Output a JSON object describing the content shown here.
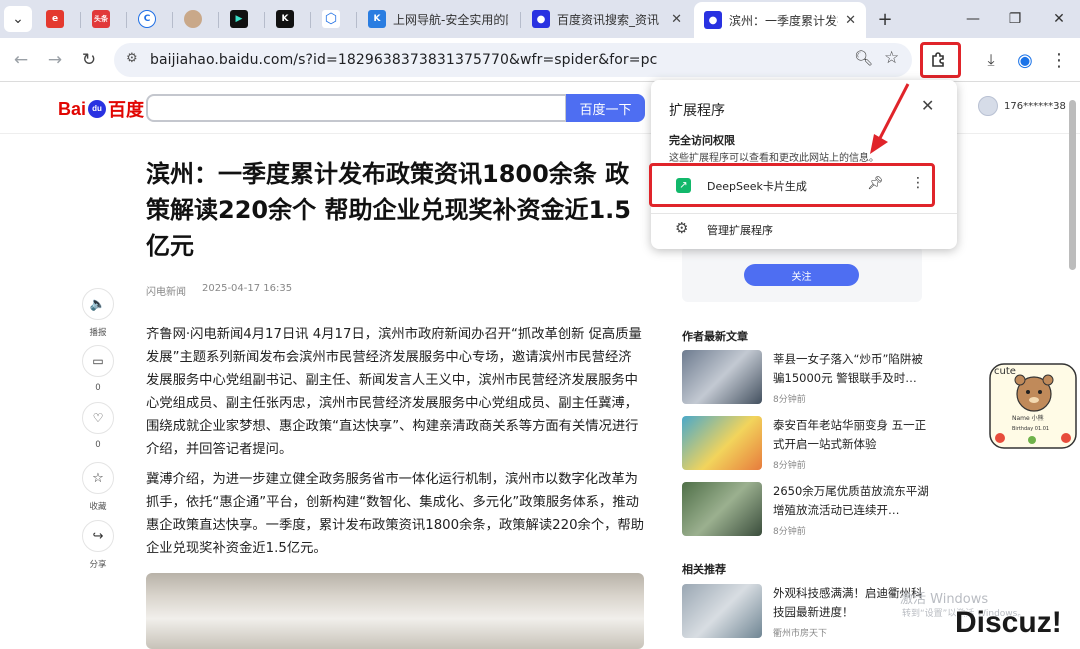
{
  "browser": {
    "tabs": [
      {
        "title": "",
        "favicon": "red-box",
        "favicon_text": "e",
        "color": "#e4392f"
      },
      {
        "title": "",
        "favicon": "toutiao",
        "favicon_text": "头条",
        "color": "#e1393a"
      },
      {
        "title": "",
        "favicon": "blue-c",
        "favicon_text": "C",
        "color": "#1f6fe5"
      },
      {
        "title": "",
        "favicon": "avatar",
        "favicon_text": "",
        "color": "#c9a889"
      },
      {
        "title": "",
        "favicon": "play",
        "favicon_text": "▶",
        "color": "#111111"
      },
      {
        "title": "",
        "favicon": "k-logo",
        "favicon_text": "K",
        "color": "#111111"
      },
      {
        "title": "",
        "favicon": "hex",
        "favicon_text": "⬡",
        "color": "#1f6fe5"
      },
      {
        "title": "上网导航-安全实用的网",
        "favicon": "k-blue",
        "favicon_text": "K",
        "color": "#2a7de1"
      },
      {
        "title": "百度资讯搜索_资讯",
        "favicon": "baidu-paw",
        "favicon_text": "🐾",
        "color": "#2932e1"
      },
      {
        "title": "滨州：一季度累计发布",
        "favicon": "baidu-paw",
        "favicon_text": "🐾",
        "color": "#2932e1",
        "active": true
      }
    ],
    "new_tab": "+",
    "url": "baijiahao.baidu.com/s?id=1829638373831375770&wfr=spider&for=pc"
  },
  "baidu": {
    "logo": "Bai百度",
    "search_button": "百度一下",
    "user": "176******38"
  },
  "article": {
    "title": "滨州：一季度累计发布政策资讯1800余条 政策解读220余个 帮助企业兑现奖补资金近1.5亿元",
    "source": "闪电新闻",
    "time": "2025-04-17 16:35",
    "para1": "齐鲁网·闪电新闻4月17日讯 4月17日，滨州市政府新闻办召开“抓改革创新 促高质量发展”主题系列新闻发布会滨州市民营经济发展服务中心专场，邀请滨州市民营经济发展服务中心党组副书记、副主任、新闻发言人王义中，滨州市民营经济发展服务中心党组成员、副主任张丙忠，滨州市民营经济发展服务中心党组成员、副主任冀溥，围绕成就企业家梦想、惠企政策“直达快享”、构建亲清政商关系等方面有关情况进行介绍，并回答记者提问。",
    "para2": "冀溥介绍，为进一步建立健全政务服务省市一体化运行机制，滨州市以数字化改革为抓手，依托“惠企通”平台，创新构建“数智化、集成化、多元化”政策服务体系，推动惠企政策直达快享。一季度，累计发布政策资讯1800余条，政策解读220余个，帮助企业兑现奖补资金近1.5亿元。"
  },
  "side_actions": [
    {
      "icon": "speaker-icon",
      "glyph": "🔈",
      "label": "播报"
    },
    {
      "icon": "comment-icon",
      "glyph": "💬",
      "label": "0"
    },
    {
      "icon": "like-icon",
      "glyph": "👍",
      "label": "0"
    },
    {
      "icon": "star-icon",
      "glyph": "☆",
      "label": "收藏"
    },
    {
      "icon": "share-icon",
      "glyph": "↪",
      "label": "分享"
    }
  ],
  "right": {
    "follow": "关注",
    "latest_heading": "作者最新文章",
    "latest": [
      {
        "title": "莘县一女子落入“炒币”陷阱被骗15000元 警银联手及时…",
        "time": "8分钟前"
      },
      {
        "title": "泰安百年老站华丽变身 五一正式开启一站式新体验",
        "time": "8分钟前"
      },
      {
        "title": "2650余万尾优质苗放流东平湖 增殖放流活动已连续开…",
        "time": "8分钟前"
      }
    ],
    "related_heading": "相关推荐",
    "related": [
      {
        "title": "外观科技感满满！启迪衢州科技园最新进度！",
        "time": "衢州市房天下"
      }
    ]
  },
  "extensions_popup": {
    "title": "扩展程序",
    "full_access_title": "完全访问权限",
    "full_access_desc": "这些扩展程序可以查看和更改此网站上的信息。",
    "extension_name": "DeepSeek卡片生成",
    "manage": "管理扩展程序"
  },
  "overlay": {
    "activate_windows": "激活 Windows",
    "activate_hint": "转到“设置”以激活 Windows。",
    "discuz": "Discuz!",
    "sticker_text": "cute",
    "sticker_name": "Name 小熊",
    "sticker_birthday": "Birthday 01.01"
  },
  "colors": {
    "accent": "#4e6ef2",
    "highlight": "#e0242a",
    "tabstrip": "#dfe3ee"
  }
}
